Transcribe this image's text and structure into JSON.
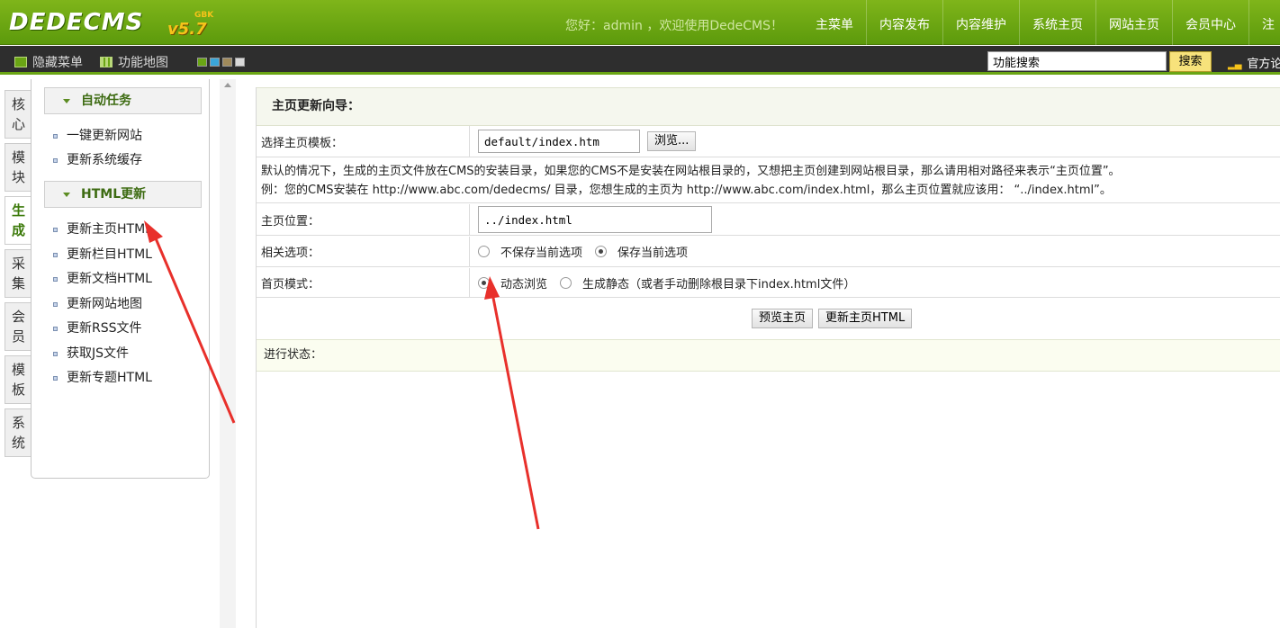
{
  "header": {
    "logo_text": "DEDECMS",
    "logo_version": "v5.7",
    "logo_edition": "GBK",
    "welcome": "您好：admin ，欢迎使用DedeCMS！",
    "nav": [
      "主菜单",
      "内容发布",
      "内容维护",
      "系统主页",
      "网站主页",
      "会员中心",
      "注"
    ]
  },
  "toolbar": {
    "hide_menu": "隐藏菜单",
    "site_map": "功能地图",
    "swatch_colors": [
      "#6aa514",
      "#3aa6d9",
      "#a08a5b",
      "#d9d9d9"
    ],
    "search_value": "功能搜索",
    "search_button": "搜索",
    "official": "官方论"
  },
  "left_tabs": [
    "核心",
    "模块",
    "生成",
    "采集",
    "会员",
    "模板",
    "系统"
  ],
  "active_tab": "生成",
  "menu": {
    "groups": [
      {
        "title": "自动任务",
        "items": [
          "一键更新网站",
          "更新系统缓存"
        ]
      },
      {
        "title": "HTML更新",
        "items": [
          "更新主页HTML",
          "更新栏目HTML",
          "更新文档HTML",
          "更新网站地图",
          "更新RSS文件",
          "获取JS文件",
          "更新专题HTML"
        ]
      }
    ]
  },
  "main": {
    "title": "主页更新向导：",
    "template_label": "选择主页模板：",
    "template_value": "default/index.htm",
    "browse_button": "浏览...",
    "note_line1": "默认的情况下，生成的主页文件放在CMS的安装目录，如果您的CMS不是安装在网站根目录的，又想把主页创建到网站根目录，那么请用相对路径来表示“主页位置”。",
    "note_line2": "例：您的CMS安装在 http://www.abc.com/dedecms/ 目录，您想生成的主页为 http://www.abc.com/index.html，那么主页位置就应该用： “../index.html”。",
    "position_label": "主页位置：",
    "position_value": "../index.html",
    "options_label": "相关选项：",
    "option_no_save": "不保存当前选项",
    "option_save": "保存当前选项",
    "option_selected": "save",
    "mode_label": "首页模式：",
    "mode_dynamic": "动态浏览",
    "mode_static": "生成静态（或者手动删除根目录下index.html文件）",
    "mode_selected": "dynamic",
    "preview_button": "预览主页",
    "update_button": "更新主页HTML",
    "status_label": "进行状态："
  },
  "colors": {
    "header_green": "#6aa514",
    "annotation_red": "#e8302b"
  }
}
